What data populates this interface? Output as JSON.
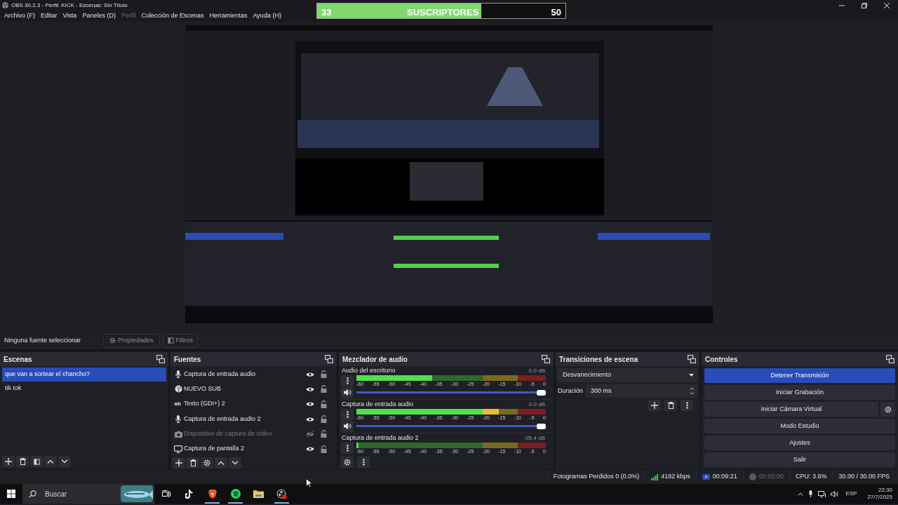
{
  "window": {
    "title": "OBS 30.2.3 - Perfil: KICK - Escenas: Sin Título"
  },
  "menu": [
    "Archivo (F)",
    "Editar",
    "Vista",
    "Paneles (D)",
    "Perfil",
    "Colección de Escenas",
    "Herramientas",
    "Ayuda (H)"
  ],
  "menu_disabled": [
    false,
    false,
    false,
    false,
    true,
    false,
    false,
    false
  ],
  "goal_bar": {
    "current": "33",
    "label": "SUSCRIPTORES",
    "target": "50",
    "level": 0.66
  },
  "source_toolbar": {
    "status": "Ninguna fuente seleccionar",
    "buttons": [
      "Propiedades",
      "Filtros"
    ]
  },
  "scenes": {
    "title": "Escenas",
    "items": [
      {
        "label": "que van a sortear el chancho?",
        "selected": true
      },
      {
        "label": "tik tok",
        "selected": false
      }
    ]
  },
  "sources": {
    "title": "Fuentes",
    "items": [
      {
        "label": "Captura de entrada audio",
        "kind": "mic",
        "visible": true
      },
      {
        "label": "NUEVO SUB",
        "kind": "browser",
        "visible": true
      },
      {
        "label": "Texto (GDI+) 2",
        "kind": "text",
        "glyph": "ab",
        "visible": true
      },
      {
        "label": "Captura de entrada audio 2",
        "kind": "mic",
        "visible": true
      },
      {
        "label": "Dispositivo de captura de vídeo",
        "kind": "camera",
        "visible": false
      },
      {
        "label": "Captura de pantalla 2",
        "kind": "display",
        "visible": true
      }
    ]
  },
  "mixer": {
    "title": "Mezclador de audio",
    "channels": [
      {
        "name": "Audio del escritorio",
        "reading": "0.0 dB",
        "level": 0.4,
        "volume": {
          "level": 1.0
        },
        "scale": [
          "-60",
          "-55",
          "-50",
          "-45",
          "-40",
          "-35",
          "-30",
          "-25",
          "-20",
          "-15",
          "-10",
          "-5",
          "0"
        ]
      },
      {
        "name": "Captura de entrada audio",
        "reading": "0.0 dB",
        "level": 0.75,
        "volume": {
          "level": 1.0
        },
        "scale": [
          "-60",
          "-55",
          "-50",
          "-45",
          "-40",
          "-35",
          "-30",
          "-25",
          "-20",
          "-15",
          "-10",
          "-5",
          "0"
        ]
      },
      {
        "name": "Captura de entrada audio 2",
        "reading": "-95.4 dB",
        "level": 0.01,
        "scale": [
          "-60",
          "-55",
          "-50",
          "-45",
          "-40",
          "-35",
          "-30",
          "-25",
          "-20",
          "-15",
          "-10",
          "-5",
          "0"
        ]
      }
    ]
  },
  "transitions": {
    "title": "Transiciones de escena",
    "selected": "Desvanecimiento",
    "duration_label": "Duración",
    "duration": "300 ms"
  },
  "controls": {
    "title": "Controles",
    "buttons": [
      {
        "label": "Detener Transmisión",
        "active": true
      },
      {
        "label": "Iniciar Grabación",
        "active": false
      },
      {
        "label": "Iniciar Cámara Virtual",
        "active": false,
        "settings": true
      },
      {
        "label": "Modo Estudio",
        "active": false
      },
      {
        "label": "Ajustes",
        "active": false
      },
      {
        "label": "Salir",
        "active": false
      }
    ]
  },
  "status_bar": {
    "dropped": "Fotogramas Perdidos 0 (0.0%)",
    "bitrate": "4182 kbps",
    "stream_time": "00:09:21",
    "record_time": "00:00:00",
    "cpu": "CPU: 3.6%",
    "fps": "30.00 / 30.00 FPS"
  },
  "taskbar": {
    "search_placeholder": "Buscar",
    "language": "ESP",
    "time": "22:30",
    "date": "27/7/2025"
  }
}
